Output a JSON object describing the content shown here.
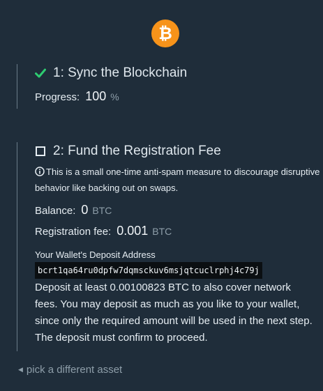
{
  "logo": {
    "icon": "bitcoin-icon",
    "symbol": "₿",
    "color": "#f7931a"
  },
  "step1": {
    "title": "1: Sync the Blockchain",
    "progress_label": "Progress:",
    "progress_value": "100",
    "progress_unit": "%",
    "status_color": "#2ecc71"
  },
  "step2": {
    "title": "2: Fund the Registration Fee",
    "info": "This is a small one-time anti-spam measure to discourage disruptive behavior like backing out on swaps.",
    "balance_label": "Balance:",
    "balance_value": "0",
    "balance_unit": "BTC",
    "fee_label": "Registration fee:",
    "fee_value": "0.001",
    "fee_unit": "BTC",
    "address_label": "Your Wallet's Deposit Address",
    "address": "bcrt1qa64ru0dpfw7dqmsckuv6msjqtcuclrphj4c79j",
    "deposit_note": "Deposit at least 0.00100823 BTC to also cover network fees. You may deposit as much as you like to your wallet, since only the required amount will be used in the next step. The deposit must confirm to proceed."
  },
  "back_link": "pick a different asset"
}
